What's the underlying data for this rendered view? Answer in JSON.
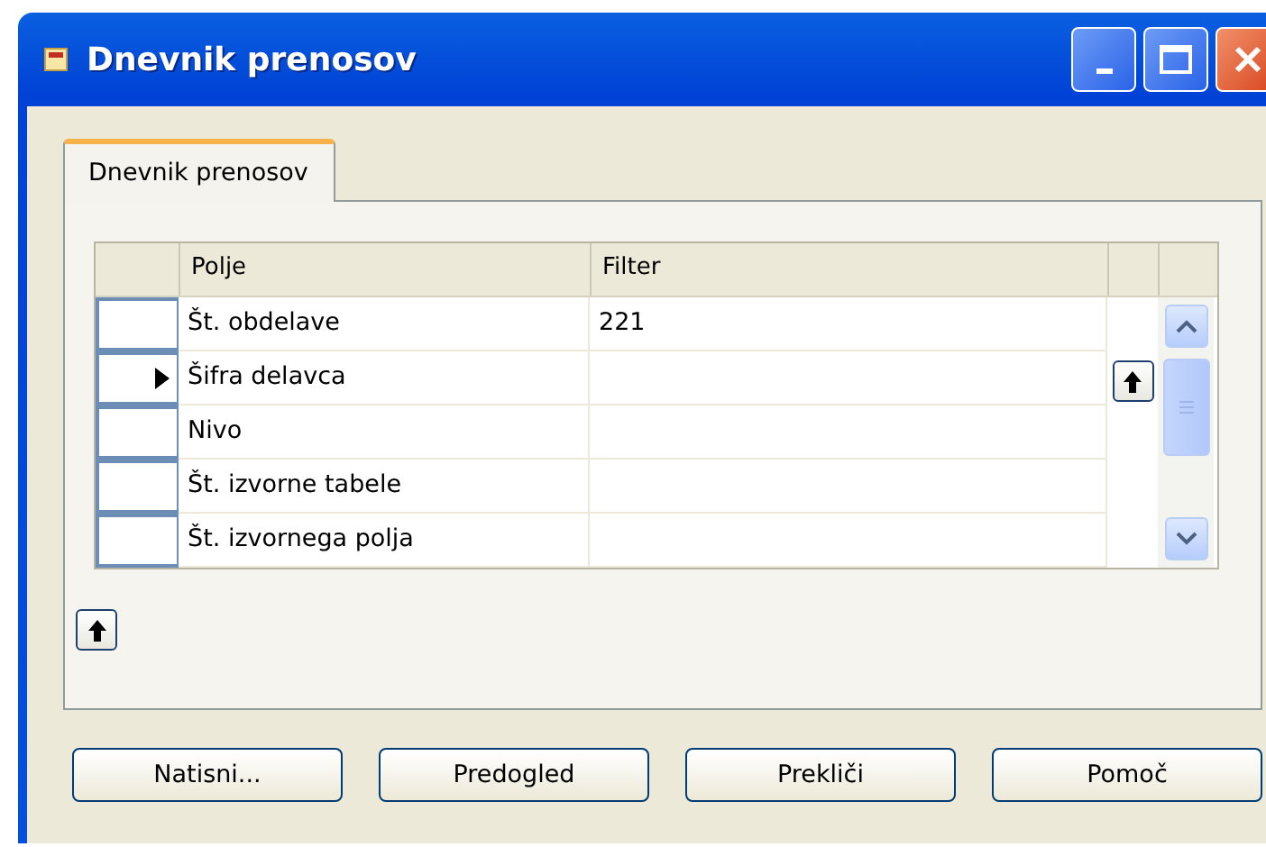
{
  "window": {
    "title": "Dnevnik prenosov"
  },
  "tabs": [
    {
      "label": "Dnevnik prenosov",
      "selected": true
    }
  ],
  "table": {
    "columns": [
      "Polje",
      "Filter"
    ],
    "rows": [
      {
        "field": "Št. obdelave",
        "filter": "221",
        "selected": false
      },
      {
        "field": "Šifra delavca",
        "filter": "",
        "selected": true
      },
      {
        "field": "Nivo",
        "filter": "",
        "selected": false
      },
      {
        "field": "Št. izvorne tabele",
        "filter": "",
        "selected": false
      },
      {
        "field": "Št. izvornega polja",
        "filter": "",
        "selected": false
      }
    ]
  },
  "buttons": [
    "Natisni...",
    "Predogled",
    "Prekliči",
    "Pomoč"
  ]
}
